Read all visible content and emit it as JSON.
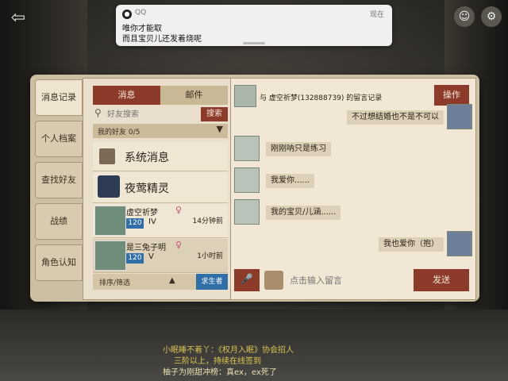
{
  "notification": {
    "app": "QQ",
    "time": "现在",
    "line1": "唯你才能取",
    "line2": "而且宝贝儿还发着烧呢"
  },
  "side_tabs": [
    "消息记录",
    "个人档案",
    "查找好友",
    "战绩",
    "角色认知"
  ],
  "left": {
    "tabs": [
      "消息",
      "邮件"
    ],
    "search_placeholder": "好友搜索",
    "search_button": "搜索",
    "friends_label": "我的好友 0/5",
    "system_messages": "系统消息",
    "contact": "夜莺精灵",
    "friends": [
      {
        "name": "虚空祈梦",
        "level": "120",
        "rank": "IV",
        "time": "14分钟前"
      },
      {
        "name": "是三兔子明",
        "level": "120",
        "rank": "V",
        "time": "1小时前"
      }
    ],
    "filter_label": "排序/筛选",
    "role_button": "求生者"
  },
  "chat": {
    "header": "与  虚空祈梦(132888739) 的留言记录",
    "ops_button": "操作",
    "messages": [
      {
        "dir": "out",
        "text": "不过想结婚也不是不可以"
      },
      {
        "dir": "in",
        "text": "刚刚呐只是练习"
      },
      {
        "dir": "in",
        "text": "我爱你......"
      },
      {
        "dir": "in",
        "text": "我的宝贝/儿涵......"
      },
      {
        "dir": "out",
        "text": "我也爱你（抱）"
      }
    ],
    "input_placeholder": "点击输入留言",
    "send_button": "发送"
  },
  "log": [
    "小眠睡不着丫：《权月入眠》协会招人",
    "三阶以上，持续在线签到",
    "柚子为刚甜冲榜：真ex，ex死了"
  ],
  "icons": {
    "exit": "exit-icon",
    "search": "magnifier-icon",
    "mic": "microphone-icon",
    "settings": "gear-icon",
    "friends": "people-icon"
  }
}
